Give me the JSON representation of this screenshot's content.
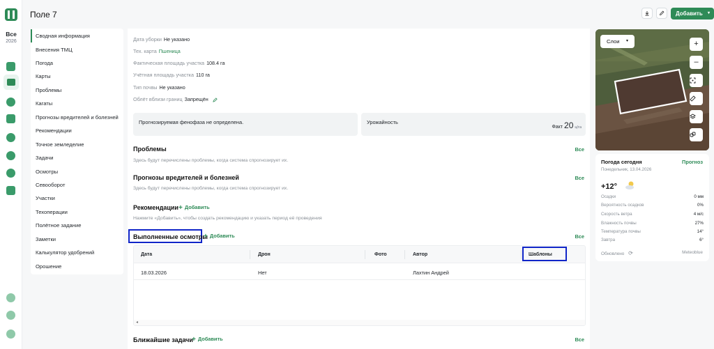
{
  "rail": {
    "season_label": "Все",
    "season_year": "2026"
  },
  "header": {
    "title": "Поле 7",
    "add_button": "Добавить",
    "icons": [
      "download-icon",
      "pencil-icon",
      "chevron-down-icon"
    ]
  },
  "menu": {
    "items": [
      "Сводная информация",
      "Внесения ТМЦ",
      "Погода",
      "Карты",
      "Проблемы",
      "Кагаты",
      "Прогнозы вредителей и болезней",
      "Рекомендации",
      "Точное земледелие",
      "Задачи",
      "Осмотры",
      "Севооборот",
      "Участки",
      "Техоперации",
      "Полётное задание",
      "Заметки",
      "Калькулятор удобрений",
      "Орошение"
    ],
    "active_index": 0
  },
  "info": {
    "harvest_date_label": "Дата уборки",
    "harvest_date_value": "Не указано",
    "techmap_label": "Тех. карта",
    "techmap_value": "Пшеница",
    "actual_area_label": "Фактическая площадь участка",
    "actual_area_value": "108.4 га",
    "accounting_area_label": "Учётная площадь участка",
    "accounting_area_value": "110 га",
    "soil_label": "Тип почвы",
    "soil_value": "Не указано",
    "flyover_label": "Облёт вблизи границ",
    "flyover_value": "Запрещён"
  },
  "cards": {
    "phenophase": "Прогнозируемая фенофаза не определена.",
    "yield_title": "Урожайность",
    "fact_label": "Факт",
    "fact_value": "20",
    "fact_unit": "ц/га"
  },
  "sections": {
    "all_label": "Все",
    "add_label": "Добавить",
    "problems_title": "Проблемы",
    "problems_hint": "Здесь будут перечислены проблемы, когда система спрогнозирует их.",
    "pests_title": "Прогнозы вредителей и болезней",
    "pests_hint": "Здесь будут перечислены проблемы, когда система спрогнозирует их.",
    "recs_title": "Рекомендации",
    "recs_hint": "Нажмите «Добавить», чтобы создать рекомендацию и указать период её проведения",
    "inspections_title": "Выполненные осмотры",
    "tasks_title": "Ближайшие задачи"
  },
  "inspections_table": {
    "columns": [
      "Дата",
      "Дрон",
      "Фото",
      "Автор",
      "Шаблоны"
    ],
    "rows": [
      {
        "date": "18.03.2026",
        "drone": "Нет",
        "photo": "",
        "author": "Лахтин Андрей",
        "templates": ""
      }
    ]
  },
  "map": {
    "layers_label": "Слои",
    "buttons": [
      "plus-icon",
      "minus-icon",
      "focus-icon",
      "ruler-icon",
      "layers-icon",
      "link-icon"
    ]
  },
  "weather": {
    "title": "Погода сегодня",
    "date": "Понедельник, 13.04.2026",
    "forecast_link": "Прогноз",
    "temperature": "+12°",
    "rows": [
      {
        "label": "Осадки",
        "value": "0 мм"
      },
      {
        "label": "Вероятность осадков",
        "value": "0%"
      },
      {
        "label": "Скорость ветра",
        "value": "4 м/с"
      },
      {
        "label": "Влажность почвы",
        "value": "27%"
      },
      {
        "label": "Температура почвы",
        "value": "14°"
      },
      {
        "label": "Завтра",
        "value": "6°"
      }
    ],
    "updated_label": "Обновлено",
    "source": "Meteoblue"
  },
  "colors": {
    "accent": "#2e8b57",
    "highlight": "#1025c8"
  }
}
